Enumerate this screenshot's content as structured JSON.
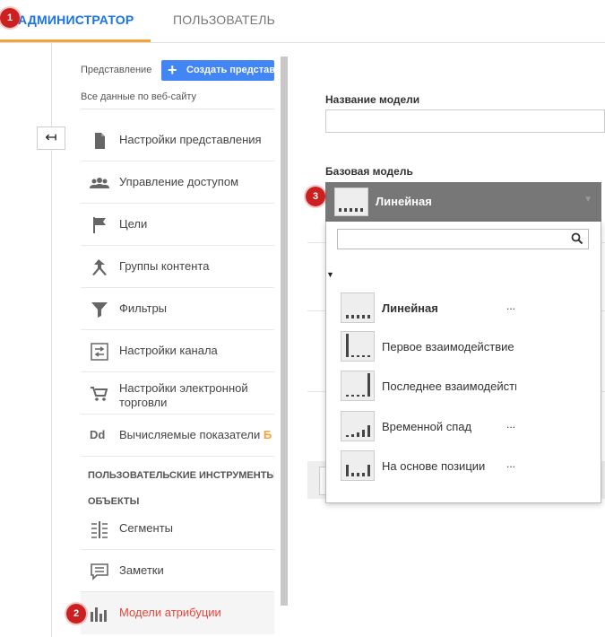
{
  "tabs": {
    "admin": "АДМИНИСТРАТОР",
    "user": "ПОЛЬЗОВАТЕЛЬ"
  },
  "badges": {
    "b1": "1",
    "b2": "2",
    "b3": "3"
  },
  "sidebar": {
    "view_label": "Представление",
    "create_button": "Создать представление",
    "view_value": "Все данные по веб-сайту",
    "items": [
      {
        "label": "Настройки представления",
        "icon": "document-icon"
      },
      {
        "label": "Управление доступом",
        "icon": "users-icon"
      },
      {
        "label": "Цели",
        "icon": "flag-icon"
      },
      {
        "label": "Группы контента",
        "icon": "merge-icon"
      },
      {
        "label": "Фильтры",
        "icon": "filter-icon"
      },
      {
        "label": "Настройки канала",
        "icon": "channel-icon"
      },
      {
        "label": "Настройки электронной торговли",
        "icon": "cart-icon"
      },
      {
        "label": "Вычисляемые показатели",
        "icon": "dd-icon",
        "icon_text": "Dd",
        "suffix": "Б"
      }
    ],
    "section_title_1": "ПОЛЬЗОВАТЕЛЬСКИЕ ИНСТРУМЕНТЫ И",
    "section_title_2": "ОБЪЕКТЫ",
    "items2": [
      {
        "label": "Сегменты",
        "icon": "segments-icon"
      },
      {
        "label": "Заметки",
        "icon": "notes-icon"
      },
      {
        "label": "Модели атрибуции",
        "icon": "attribution-icon"
      }
    ]
  },
  "form": {
    "model_name_label": "Название модели",
    "model_name_value": "",
    "base_model_label": "Базовая модель"
  },
  "dropdown": {
    "selected": "Линейная",
    "search_value": "",
    "options": [
      {
        "label": "Линейная",
        "dots": "...",
        "bold": true
      },
      {
        "label": "Первое взаимодействие",
        "dots": ""
      },
      {
        "label": "Последнее взаимодействие",
        "dots": ""
      },
      {
        "label": "Временной спад",
        "dots": "..."
      },
      {
        "label": "На основе позиции",
        "dots": "..."
      }
    ]
  },
  "colors": {
    "accent_blue": "#1a73e8",
    "tab_underline": "#f4a33a",
    "badge_red": "#cc1f1f",
    "active_red": "#e8453c"
  }
}
